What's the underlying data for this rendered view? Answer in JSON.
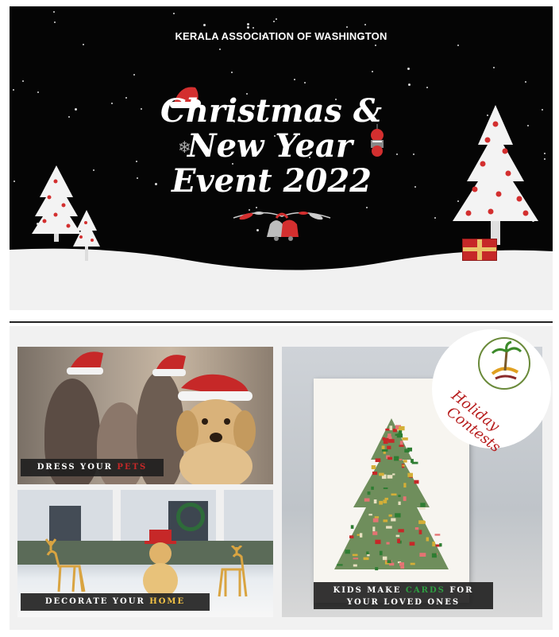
{
  "banner": {
    "organization": "KERALA ASSOCIATION OF WASHINGTON",
    "title_line1": "Christmas &",
    "title_line2": "New Year",
    "title_line3": "Event  2022",
    "colors": {
      "background": "#050505",
      "snow": "#f1f1f1",
      "accent": "#d32f2f"
    }
  },
  "collage": {
    "caption_pets": {
      "prefix": "DRESS YOUR ",
      "highlight": "PETS"
    },
    "caption_home": {
      "prefix": "DECORATE YOUR ",
      "highlight": "HOME"
    },
    "caption_cards": {
      "prefix": "KIDS MAKE ",
      "highlight": "CARDS",
      "suffix": " FOR",
      "line2": "YOUR LOVED ONES"
    },
    "badge": {
      "line1": "Holiday",
      "line2": "Contests"
    }
  }
}
